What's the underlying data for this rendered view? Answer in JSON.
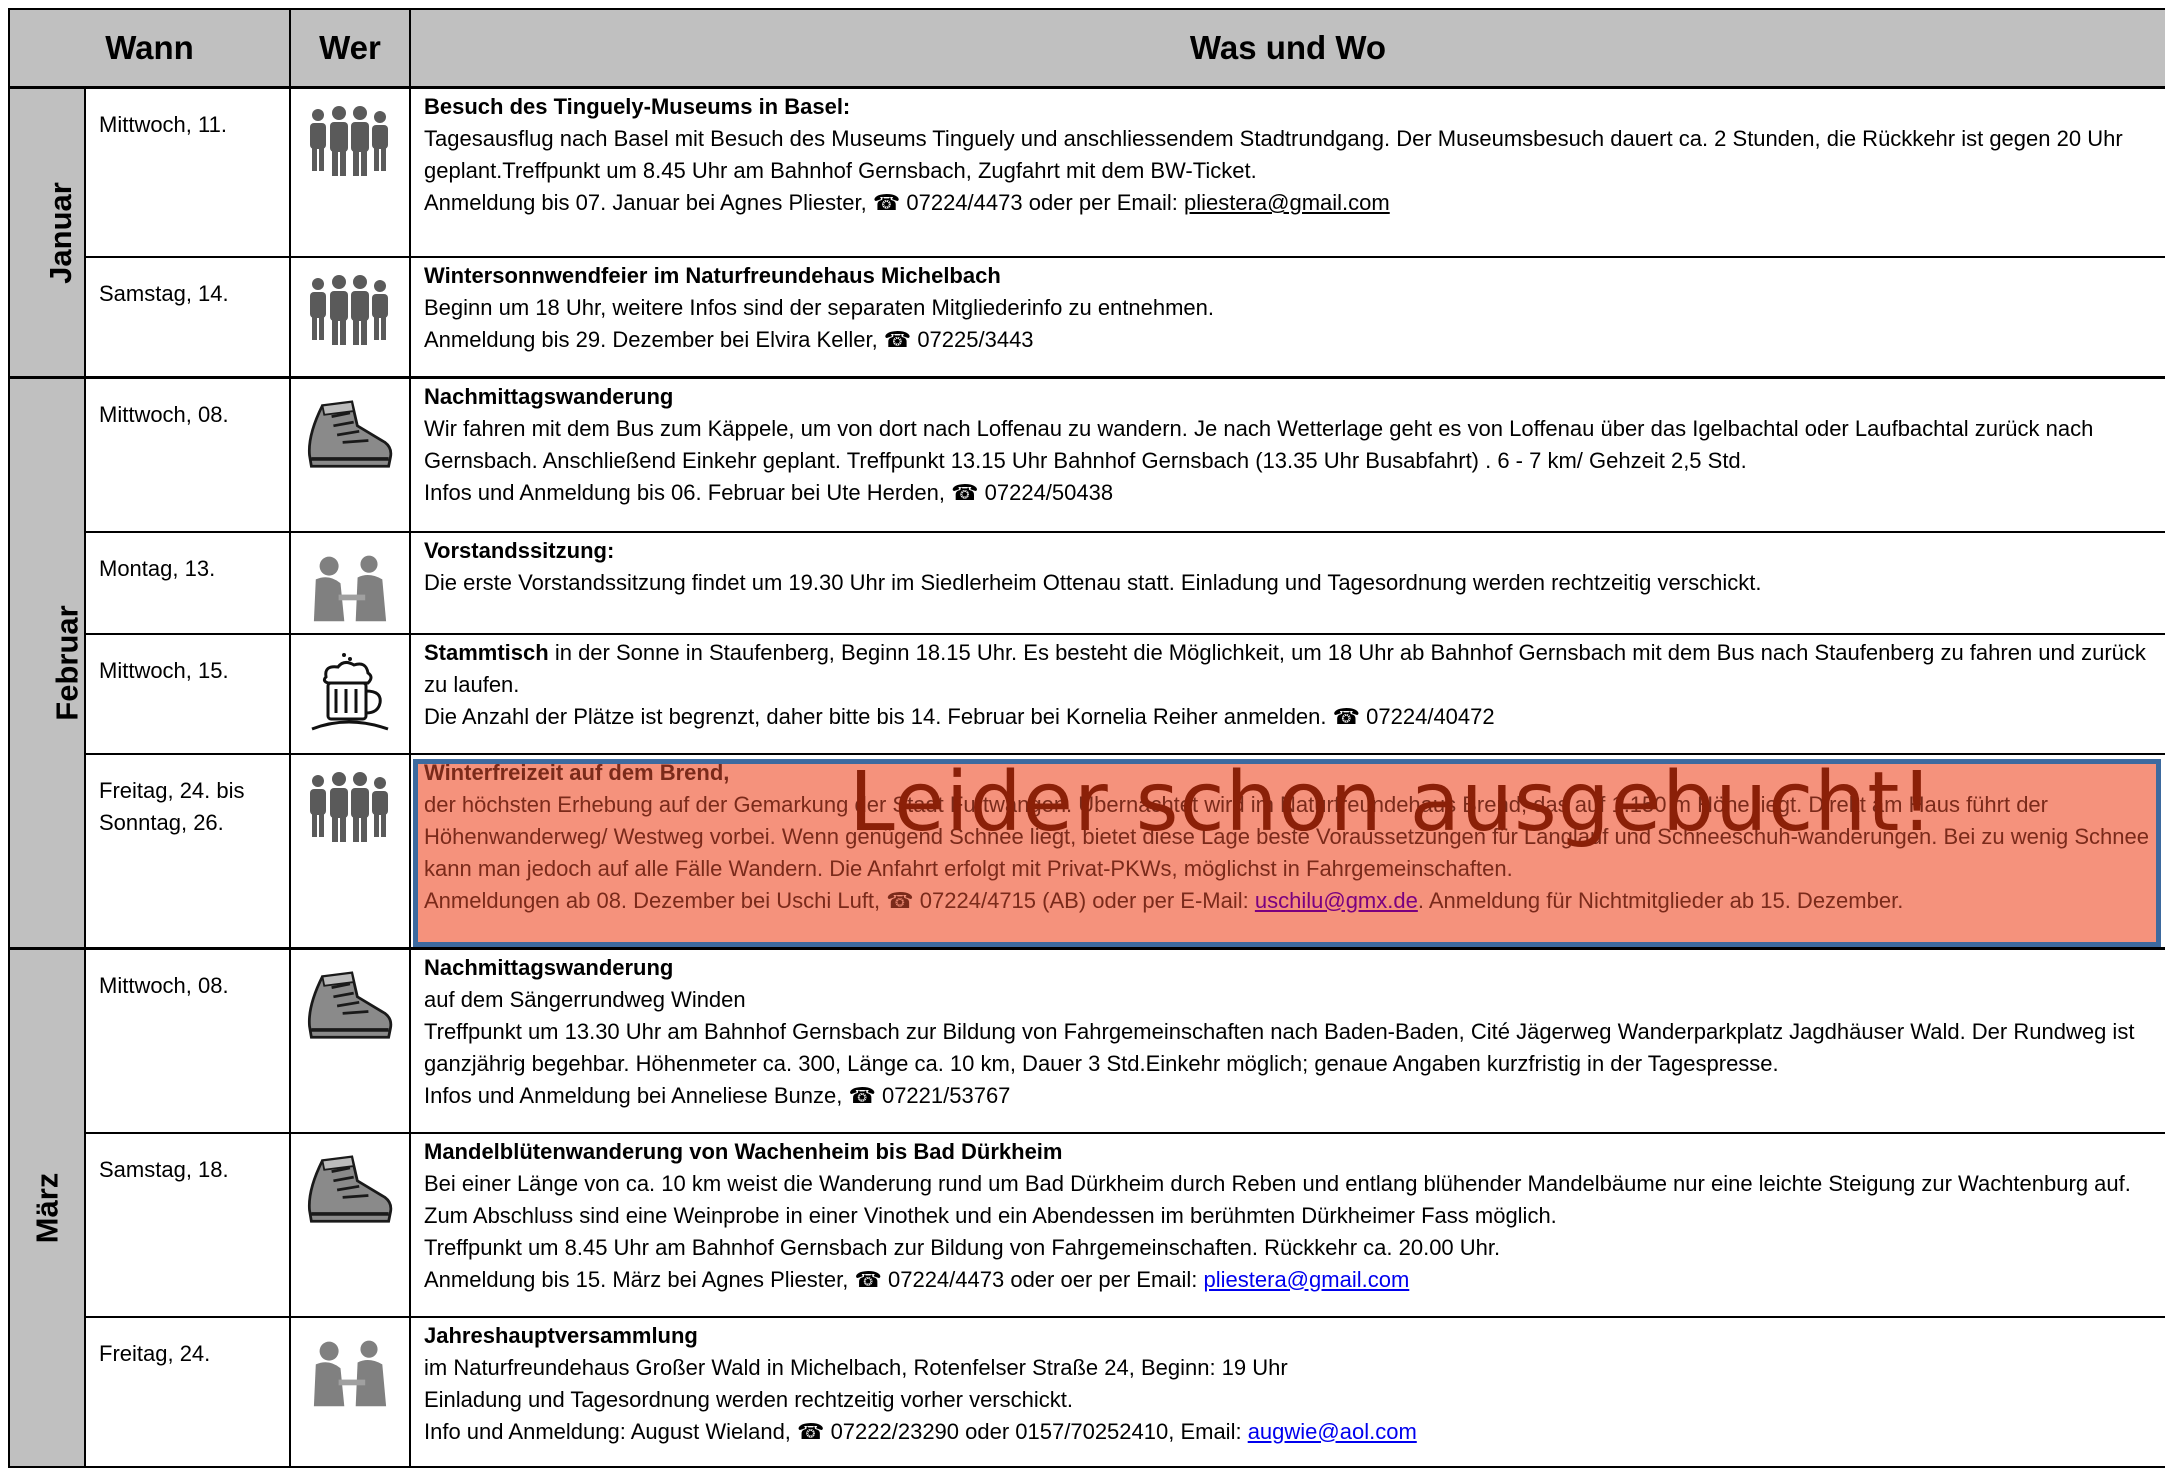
{
  "header": {
    "col1": "Wann",
    "col2": "Wer",
    "col3": "Was und Wo"
  },
  "months": {
    "jan": "Januar",
    "feb": "Februar",
    "mar": "März"
  },
  "stamp": "Leider schon ausgebucht!",
  "phone_icon": "phone-icon",
  "colors": {
    "header_bg": "#c0c0c0",
    "highlight_bg": "#f5927c",
    "highlight_border": "#3d6a9f"
  },
  "events": [
    {
      "date": "Mittwoch, 11.",
      "icon": "family-icon",
      "title": "Besuch des Tinguely-Museums in Basel:",
      "line1": "Tagesausflug nach Basel mit Besuch des Museums Tinguely und anschliessendem Stadtrundgang. Der Museumsbesuch dauert ca. 2 Stunden, die Rückkehr ist gegen 20 Uhr geplant.Treffpunkt um 8.45 Uhr am Bahnhof Gernsbach, Zugfahrt mit dem BW-Ticket.",
      "line2_pre": "Anmeldung bis 07. Januar bei Agnes Pliester, ",
      "line2_mid": " 07224/4473 oder per Email: ",
      "email": "pliestera@gmail.com"
    },
    {
      "date": "Samstag, 14.",
      "icon": "family-icon",
      "title": "Wintersonnwendfeier im Naturfreundehaus Michelbach",
      "line1": "Beginn um 18 Uhr, weitere Infos sind der separaten Mitgliederinfo zu entnehmen.",
      "line2_pre": "Anmeldung bis 29. Dezember bei Elvira Keller, ",
      "line2_mid": " 07225/3443"
    },
    {
      "date": "Mittwoch, 08.",
      "icon": "hiking-boot-icon",
      "title": "Nachmittagswanderung",
      "line1": "Wir fahren mit dem Bus zum Käppele, um von dort nach Loffenau zu wandern. Je nach Wetterlage geht es von Loffenau über das Igelbachtal oder Laufbachtal zurück nach Gernsbach. Anschließend Einkehr geplant. Treffpunkt 13.15 Uhr Bahnhof Gernsbach (13.35 Uhr Busabfahrt) . 6 - 7 km/ Gehzeit 2,5 Std.",
      "line2_pre": "Infos und Anmeldung bis 06. Februar bei Ute Herden, ",
      "line2_mid": " 07224/50438"
    },
    {
      "date": "Montag, 13.",
      "icon": "meeting-icon",
      "title": "Vorstandssitzung:",
      "line1": "Die erste Vorstandssitzung findet um 19.30 Uhr im Siedlerheim Ottenau statt. Einladung und Tagesordnung werden rechtzeitig verschickt."
    },
    {
      "date": "Mittwoch, 15.",
      "icon": "beer-mug-icon",
      "title": "Stammtisch",
      "title_rest": " in der Sonne in Staufenberg, Beginn 18.15 Uhr. Es besteht die Möglichkeit, um 18 Uhr ab Bahnhof Gernsbach mit dem Bus nach Staufenberg zu fahren und zurück zu laufen.",
      "line2_pre": "Die Anzahl der Plätze ist begrenzt, daher bitte bis 14. Februar bei Kornelia Reiher anmelden. ",
      "line2_mid": " 07224/40472"
    },
    {
      "date": "Freitag, 24. bis",
      "date2": "Sonntag, 26.",
      "icon": "family-icon",
      "title": "Winterfreizeit auf dem Brend,",
      "line1": "der höchsten Erhebung auf der Gemarkung der Stadt Furtwangen. Übernachtet wird im Naturfreundehaus Brend, das auf 1.150 m Höhe liegt. Direkt am Haus führt der Höhenwanderweg/ Westweg vorbei. Wenn genügend Schnee liegt, bietet diese Lage beste Voraussetzungen für Langlauf und Schneeschuh-wanderungen. Bei zu wenig Schnee kann man jedoch auf alle Fälle Wandern. Die Anfahrt erfolgt mit Privat-PKWs, möglichst in Fahrgemeinschaften.",
      "line2_pre": "Anmeldungen ab 08. Dezember bei Uschi Luft, ",
      "line2_mid": " 07224/4715 (AB) oder per E-Mail: ",
      "email": "uschilu@gmx.de",
      "line2_post": ". Anmeldung für Nichtmitglieder ab 15. Dezember."
    },
    {
      "date": "Mittwoch, 08.",
      "icon": "hiking-boot-icon",
      "title": "Nachmittagswanderung",
      "line1": "auf dem Sängerrundweg Winden",
      "line1b": "Treffpunkt um 13.30 Uhr am Bahnhof Gernsbach zur Bildung von Fahrgemeinschaften nach Baden-Baden, Cité Jägerweg Wanderparkplatz Jagdhäuser Wald. Der Rundweg ist ganzjährig begehbar. Höhenmeter ca. 300, Länge ca. 10 km, Dauer 3 Std.Einkehr möglich; genaue Angaben kurzfristig in der Tagespresse.",
      "line2_pre": "Infos und Anmeldung bei Anneliese Bunze, ",
      "line2_mid": " 07221/53767"
    },
    {
      "date": "Samstag, 18.",
      "icon": "hiking-boot-icon",
      "title": "Mandelblütenwanderung von Wachenheim bis Bad Dürkheim",
      "line1": "Bei einer Länge von ca. 10 km weist die Wanderung rund um Bad Dürkheim durch Reben und entlang blühender Mandelbäume nur eine leichte Steigung zur Wachtenburg auf. Zum Abschluss sind eine Weinprobe in einer Vinothek und ein Abendessen im berühmten Dürkheimer Fass möglich.",
      "line1b": "Treffpunkt um 8.45 Uhr am Bahnhof Gernsbach zur Bildung von Fahrgemeinschaften. Rückkehr ca. 20.00 Uhr.",
      "line2_pre": "Anmeldung bis 15. März bei Agnes Pliester, ",
      "line2_mid": " 07224/4473 oder oer per Email: ",
      "email": "pliestera@gmail.com"
    },
    {
      "date": "Freitag, 24.",
      "icon": "meeting-icon",
      "title": "Jahreshauptversammlung",
      "line1": "im Naturfreundehaus Großer Wald in Michelbach, Rotenfelser Straße 24, Beginn: 19 Uhr",
      "line1b": "Einladung und Tagesordnung werden rechtzeitig vorher verschickt.",
      "line2_pre": "Info und Anmeldung: August Wieland, ",
      "line2_mid": " 07222/23290 oder 0157/70252410, Email: ",
      "email": "augwie@aol.com"
    }
  ]
}
